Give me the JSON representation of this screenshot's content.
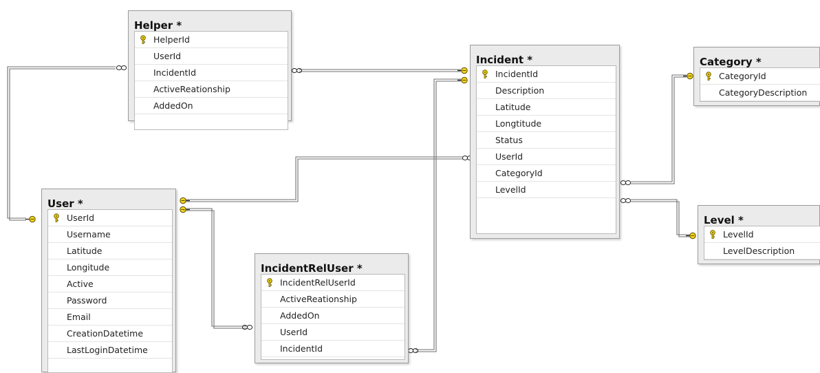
{
  "colors": {
    "key": "#f0d21a",
    "keyOutline": "#6b5c00",
    "connector": "#7a7a7a"
  },
  "tables": {
    "helper": {
      "title": "Helper *",
      "columns": [
        "HelperId",
        "UserId",
        "IncidentId",
        "ActiveReationship",
        "AddedOn"
      ],
      "primary_key": "HelperId"
    },
    "incident": {
      "title": "Incident *",
      "columns": [
        "IncidentId",
        "Description",
        "Latitude",
        "Longtitude",
        "Status",
        "UserId",
        "CategoryId",
        "LevelId"
      ],
      "primary_key": "IncidentId"
    },
    "category": {
      "title": "Category *",
      "columns": [
        "CategoryId",
        "CategoryDescription"
      ],
      "primary_key": "CategoryId"
    },
    "user": {
      "title": "User *",
      "columns": [
        "UserId",
        "Username",
        "Latitude",
        "Longitude",
        "Active",
        "Password",
        "Email",
        "CreationDatetime",
        "LastLoginDatetime"
      ],
      "primary_key": "UserId"
    },
    "incidentreluser": {
      "title": "IncidentRelUser *",
      "columns": [
        "IncidentRelUserId",
        "ActiveReationship",
        "AddedOn",
        "UserId",
        "IncidentId"
      ],
      "primary_key": "IncidentRelUserId"
    },
    "level": {
      "title": "Level *",
      "columns": [
        "LevelId",
        "LevelDescription"
      ],
      "primary_key": "LevelId"
    }
  },
  "relationships": [
    {
      "from": "helper",
      "to": "user"
    },
    {
      "from": "helper",
      "to": "incident"
    },
    {
      "from": "incidentreluser",
      "to": "incident"
    },
    {
      "from": "incident",
      "to": "user"
    },
    {
      "from": "incidentreluser",
      "to": "user"
    },
    {
      "from": "incident",
      "to": "category"
    },
    {
      "from": "incident",
      "to": "level"
    }
  ]
}
